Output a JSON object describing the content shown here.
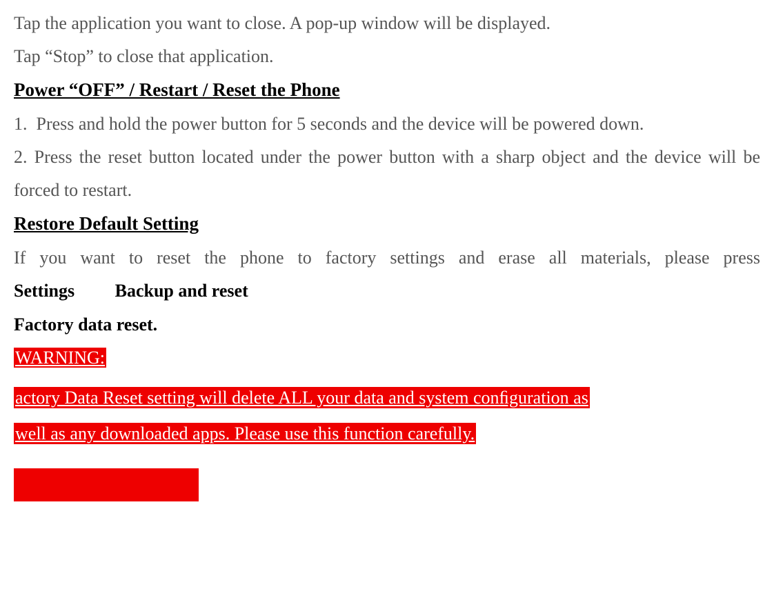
{
  "intro": {
    "line1": "Tap the application you want to close. A pop-up window will be displayed.",
    "line2": "Tap “Stop” to close that application."
  },
  "section_power": {
    "heading": "Power “OFF” / Restart / Reset the Phone",
    "step1": "1.  Press and hold the power button for 5 seconds and the device will be powered down.",
    "step2": "2. Press the reset button located under the power button with a sharp object and the device will be forced to restart."
  },
  "section_restore": {
    "heading": "Restore Default Setting",
    "text_before": "If you want to reset the phone to factory settings and erase all materials, please press ",
    "settings": "Settings",
    "gap": "         ",
    "backup": "Backup and reset",
    "factory": "Factory data reset."
  },
  "warning": {
    "label": "WARNING:",
    "line1": "actory Data Reset setting will delete ALL your data and system conﬁguration as",
    "line2": "well as any downloaded apps. Please use this function carefully."
  }
}
